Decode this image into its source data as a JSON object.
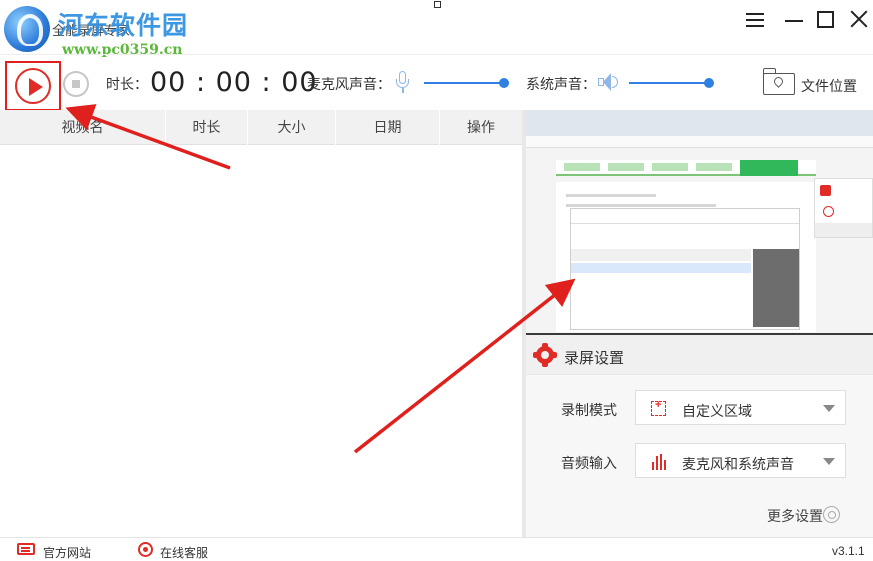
{
  "window": {
    "app_title": "全能录屏专家",
    "watermark_title": "河东软件园",
    "watermark_url": "www.pc0359.cn"
  },
  "toolbar": {
    "duration_label": "时长：",
    "timer": "00 : 00 : 00",
    "mic_label": "麦克风声音：",
    "mic_volume": 1.0,
    "system_label": "系统声音：",
    "system_volume": 1.0,
    "folder_label": "文件位置"
  },
  "list": {
    "columns": [
      "视频名",
      "时长",
      "大小",
      "日期",
      "操作"
    ],
    "rows": []
  },
  "settings": {
    "title": "录屏设置",
    "record_mode_label": "录制模式",
    "record_mode_value": "自定义区域",
    "audio_input_label": "音频输入",
    "audio_input_value": "麦克风和系统声音",
    "more_label": "更多设置"
  },
  "statusbar": {
    "website": "官方网站",
    "service": "在线客服",
    "version": "v3.1.1"
  },
  "colors": {
    "accent": "#e12b27",
    "slider": "#2f80e0",
    "annotation": "#e0201c"
  }
}
